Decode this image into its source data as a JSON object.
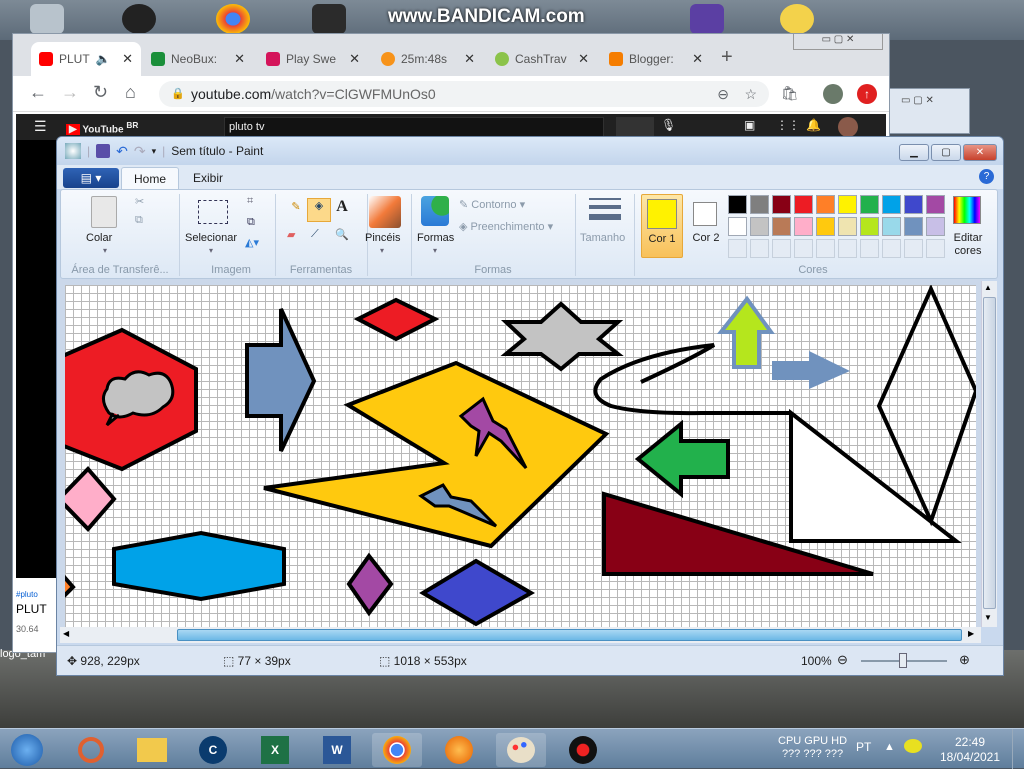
{
  "watermark": "www.BANDICAM.com",
  "browser": {
    "tabs": [
      {
        "label": "PLUT",
        "color": "#ff0000",
        "active": true
      },
      {
        "label": "NeoBux:",
        "color": "#1a8f3a"
      },
      {
        "label": "Play Swe",
        "color": "#d4145a"
      },
      {
        "label": "25m:48s",
        "color": "#f7931a"
      },
      {
        "label": "CashTrav",
        "color": "#8bc34a"
      },
      {
        "label": "Blogger:",
        "color": "#f57d00"
      }
    ],
    "close_glyph": "✕",
    "new_tab": "+",
    "url_host": "youtube.com",
    "url_path": "/watch?v=ClGWFMUnOs0",
    "youtube": {
      "logo": "YouTube",
      "region": "BR",
      "search": "pluto tv",
      "hashtag": "#pluto",
      "title": "PLUT",
      "views": "30.64"
    },
    "desktop_label": "logo_tam"
  },
  "paint": {
    "title": "Sem título - Paint",
    "tabs": [
      "Home",
      "Exibir"
    ],
    "groups": {
      "clipboard": {
        "label": "Área de Transferê...",
        "paste": "Colar"
      },
      "image": {
        "label": "Imagem",
        "select": "Selecionar"
      },
      "tools": {
        "label": "Ferramentas"
      },
      "brushes": "Pincéis",
      "shapes": {
        "label": "Formas",
        "button": "Formas",
        "outline": "Contorno",
        "fill": "Preenchimento"
      },
      "size": "Tamanho",
      "colors": {
        "label": "Cores",
        "color1": "Cor 1",
        "color2": "Cor 2",
        "edit": "Editar cores",
        "color1_value": "#fff200",
        "color2_value": "#ffffff"
      }
    },
    "palette": [
      "#000000",
      "#7f7f7f",
      "#880015",
      "#ed1c24",
      "#ff7f27",
      "#fff200",
      "#22b14c",
      "#00a2e8",
      "#3f48cc",
      "#a349a4",
      "#ffffff",
      "#c3c3c3",
      "#b97a57",
      "#ffaec9",
      "#ffc90e",
      "#efe4b0",
      "#b5e61d",
      "#99d9ea",
      "#7092be",
      "#c8bfe7"
    ],
    "status": {
      "cursor": "928, 229px",
      "selection": "77 × 39px",
      "canvas_size": "1018 × 553px",
      "zoom": "100%",
      "zoom_level": 100
    }
  },
  "taskbar": {
    "tray": {
      "hw_label": "CPU GPU HD",
      "hw_values": "???   ???  ???",
      "lang": "PT",
      "time": "22:49",
      "date": "18/04/2021"
    }
  }
}
